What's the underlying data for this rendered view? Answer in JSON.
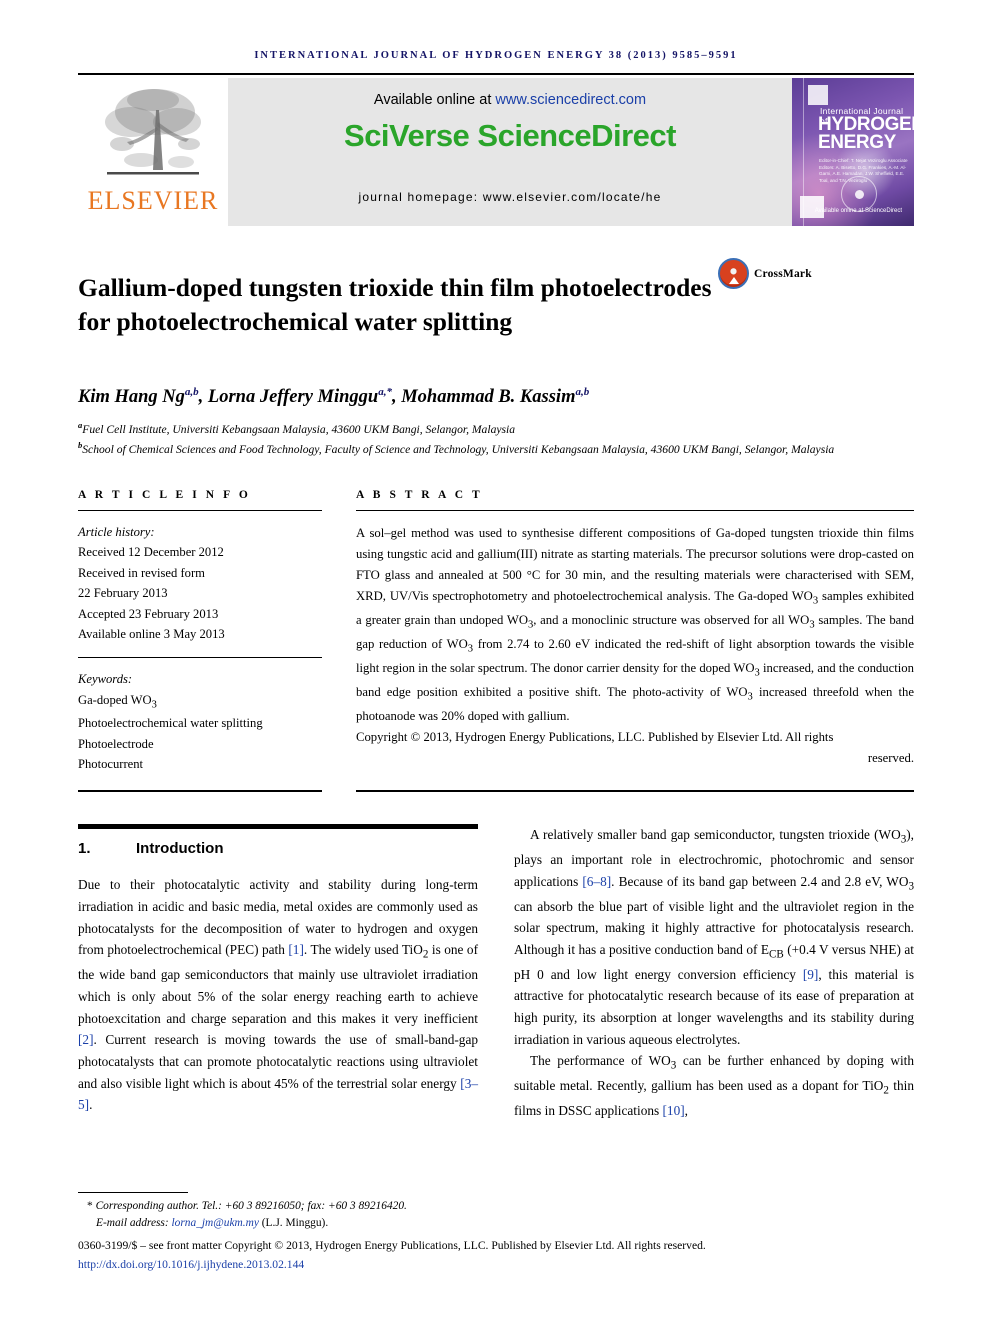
{
  "running_head": "International Journal of Hydrogen Energy 38 (2013) 9585–9591",
  "masthead": {
    "publisher_name": "ELSEVIER",
    "available_text": "Available online at ",
    "available_link": "www.sciencedirect.com",
    "brand": "SciVerse ScienceDirect",
    "homepage": "journal homepage: www.elsevier.com/locate/he",
    "cover": {
      "line1": "International Journal of",
      "line2": "HYDROGEN",
      "line3": "ENERGY",
      "editors": "Editor-in-Chief:  T. Nejat Veziroglu\nAssociate Editors:  A. Bisetto, D.G. Frankies, A.-M. Al-Garni, A.E. Hamadan, J.W. Sheffield, E.E. Toal, and T.N. Veziroglu",
      "science_direct": "Available online at ScienceDirect"
    }
  },
  "article": {
    "title": "Gallium-doped tungsten trioxide thin film photoelectrodes for photoelectrochemical water splitting",
    "crossmark_label": "CrossMark",
    "authors_html": "Kim Hang Ng<sup>a,b</sup>, Lorna Jeffery Minggu<sup>a,*</sup>, Mohammad B. Kassim<sup>a,b</sup>",
    "affiliations": [
      {
        "marker": "a",
        "text": "Fuel Cell Institute, Universiti Kebangsaan Malaysia, 43600 UKM Bangi, Selangor, Malaysia"
      },
      {
        "marker": "b",
        "text": "School of Chemical Sciences and Food Technology, Faculty of Science and Technology, Universiti Kebangsaan Malaysia, 43600 UKM Bangi, Selangor, Malaysia"
      }
    ]
  },
  "article_info": {
    "heading": "A R T I C L E   I N F O",
    "history_label": "Article history:",
    "history": [
      "Received 12 December 2012",
      "Received in revised form",
      "22 February 2013",
      "Accepted 23 February 2013",
      "Available online 3 May 2013"
    ],
    "keywords_label": "Keywords:",
    "keywords_html": [
      "Ga-doped WO<sub>3</sub>",
      "Photoelectrochemical water splitting",
      "Photoelectrode",
      "Photocurrent"
    ]
  },
  "abstract": {
    "heading": "A B S T R A C T",
    "body_html": "A sol–gel method was used to synthesise different compositions of Ga-doped tungsten trioxide thin films using tungstic acid and gallium(III) nitrate as starting materials. The precursor solutions were drop-casted on FTO glass and annealed at 500 °C for 30 min, and the resulting materials were characterised with SEM, XRD, UV/Vis spectrophotometry and photoelectrochemical analysis. The Ga-doped WO<sub>3</sub> samples exhibited a greater grain than undoped WO<sub>3</sub>, and a monoclinic structure was observed for all WO<sub>3</sub> samples. The band gap reduction of WO<sub>3</sub> from 2.74 to 2.60 eV indicated the red-shift of light absorption towards the visible light region in the solar spectrum. The donor carrier density for the doped WO<sub>3</sub> increased, and the conduction band edge position exhibited a positive shift. The photo-activity of WO<sub>3</sub> increased threefold when the photoanode was 20% doped with gallium.",
    "copyright_html": "Copyright © 2013, Hydrogen Energy Publications, LLC. Published by Elsevier Ltd. All rights",
    "copyright_tail": "reserved."
  },
  "section": {
    "number": "1.",
    "title": "Introduction",
    "left_paragraphs_html": [
      "Due to their photocatalytic activity and stability during long-term irradiation in acidic and basic media, metal oxides are commonly used as photocatalysts for the decomposition of water to hydrogen and oxygen from photoelectrochemical (PEC) path <span class=\"ref\">[1]</span>. The widely used TiO<sub>2</sub> is one of the wide band gap semiconductors that mainly use ultraviolet irradiation which is only about 5% of the solar energy reaching earth to achieve photoexcitation and charge separation and this makes it very inefficient <span class=\"ref\">[2]</span>. Current research is moving towards the use of small-band-gap photocatalysts that can promote photocatalytic reactions using ultraviolet and also visible light which is about 45% of the terrestrial solar energy <span class=\"ref\">[3–5]</span>."
    ],
    "right_paragraphs_html": [
      "A relatively smaller band gap semiconductor, tungsten trioxide (WO<sub>3</sub>), plays an important role in electrochromic, photochromic and sensor applications <span class=\"ref\">[6–8]</span>. Because of its band gap between 2.4 and 2.8 eV, WO<sub>3</sub> can absorb the blue part of visible light and the ultraviolet region in the solar spectrum, making it highly attractive for photocatalysis research. Although it has a positive conduction band of E<sub>CB</sub> (+0.4 V versus NHE) at pH 0 and low light energy conversion efficiency <span class=\"ref\">[9]</span>, this material is attractive for photocatalytic research because of its ease of preparation at high purity, its absorption at longer wavelengths and its stability during irradiation in various aqueous electrolytes.",
      "The performance of WO<sub>3</sub> can be further enhanced by doping with suitable metal. Recently, gallium has been used as a dopant for TiO<sub>2</sub> thin films in DSSC applications <span class=\"ref\">[10]</span>,"
    ]
  },
  "footnote": {
    "corresponding": "Corresponding author. Tel.: +60 3 89216050; fax: +60 3 89216420.",
    "email_label": "E-mail address: ",
    "email": "lorna_jm@ukm.my",
    "email_suffix": " (L.J. Minggu).",
    "issn_line": "0360-3199/$ – see front matter Copyright © 2013, Hydrogen Energy Publications, LLC. Published by Elsevier Ltd. All rights reserved.",
    "doi": "http://dx.doi.org/10.1016/j.ijhydene.2013.02.144"
  }
}
